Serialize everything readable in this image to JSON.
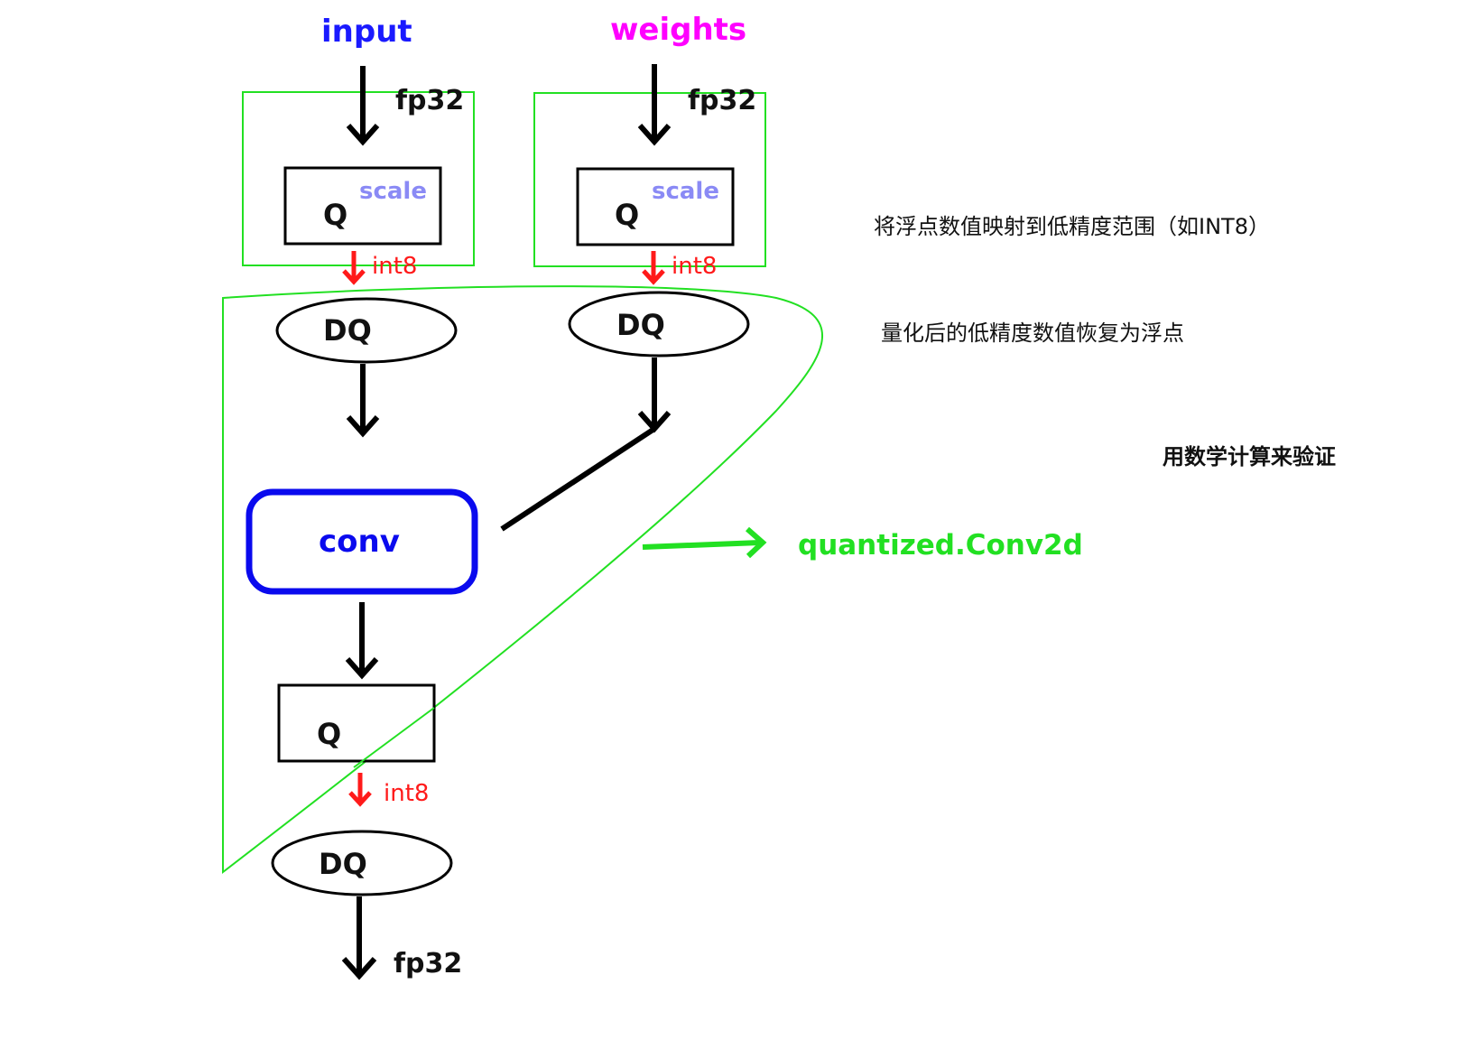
{
  "colors": {
    "input": "#1a1aff",
    "weights": "#ff00ff",
    "conv": "#0a0aee",
    "scale": "#8a8af5",
    "int8": "#ff1a1a",
    "fused_boundary": "#22e022",
    "quantized_label": "#22e022",
    "stroke": "#000000"
  },
  "top_labels": {
    "input": "input",
    "weights": "weights"
  },
  "precision_labels": {
    "input_fp32": "fp32",
    "weights_fp32": "fp32",
    "output_fp32": "fp32",
    "input_int8": "int8",
    "weights_int8": "int8",
    "output_int8": "int8"
  },
  "nodes": {
    "input_q": "Q",
    "input_q_scale": "scale",
    "weights_q": "Q",
    "weights_q_scale": "scale",
    "input_dq": "DQ",
    "weights_dq": "DQ",
    "conv": "conv",
    "output_q": "Q",
    "output_dq": "DQ"
  },
  "annotations": {
    "quantize_note": "将浮点数值映射到低精度范围（如INT8）",
    "dequantize_note": "量化后的低精度数值恢复为浮点",
    "verify_note": "用数学计算来验证",
    "fused_op_label": "quantized.Conv2d"
  }
}
